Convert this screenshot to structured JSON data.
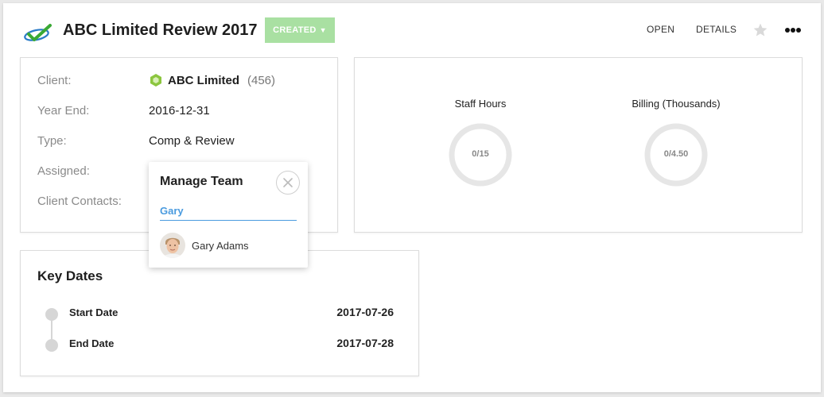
{
  "header": {
    "title": "ABC Limited Review 2017",
    "status": "CREATED",
    "status_color": "#a9e0a2",
    "open_label": "OPEN",
    "details_label": "DETAILS",
    "star_icon": "star-icon",
    "more_icon": "more-horizontal-icon"
  },
  "info": {
    "client_label": "Client:",
    "client_name": "ABC Limited",
    "client_count": "(456)",
    "year_end_label": "Year End:",
    "year_end_value": "2016-12-31",
    "type_label": "Type:",
    "type_value": "Comp & Review",
    "assigned_label": "Assigned:",
    "contacts_label": "Client Contacts:"
  },
  "stats": {
    "staff_hours_title": "Staff Hours",
    "staff_hours_value": "0/15",
    "staff_hours_progress": 0,
    "billing_title": "Billing (Thousands)",
    "billing_value": "0/4.50",
    "billing_progress": 0
  },
  "key_dates": {
    "title": "Key Dates",
    "items": [
      {
        "label": "Start Date",
        "date": "2017-07-26"
      },
      {
        "label": "End Date",
        "date": "2017-07-28"
      }
    ]
  },
  "manage_team": {
    "title": "Manage Team",
    "search_value": "Gary",
    "results": [
      {
        "name": "Gary Adams"
      }
    ]
  },
  "colors": {
    "accent_blue": "#4a9bdf",
    "client_icon_green": "#8cc63f"
  }
}
